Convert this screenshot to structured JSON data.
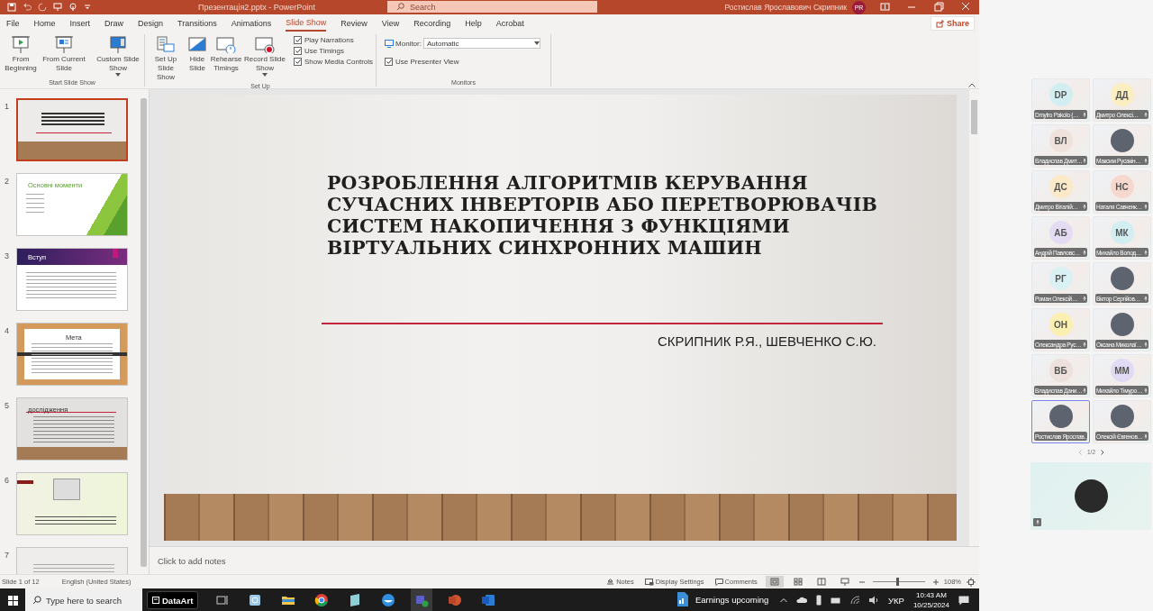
{
  "title_bar": {
    "file_title": "Презентація2.pptx - PowerPoint",
    "search": {
      "placeholder": "Search"
    },
    "user_name": "Ростислав Ярославович Скрипник",
    "avatar": "PR"
  },
  "tabs": [
    {
      "label": "File",
      "selected": false
    },
    {
      "label": "Home",
      "selected": false
    },
    {
      "label": "Insert",
      "selected": false
    },
    {
      "label": "Draw",
      "selected": false
    },
    {
      "label": "Design",
      "selected": false
    },
    {
      "label": "Transitions",
      "selected": false
    },
    {
      "label": "Animations",
      "selected": false
    },
    {
      "label": "Slide Show",
      "selected": true
    },
    {
      "label": "Review",
      "selected": false
    },
    {
      "label": "View",
      "selected": false
    },
    {
      "label": "Recording",
      "selected": false
    },
    {
      "label": "Help",
      "selected": false
    },
    {
      "label": "Acrobat",
      "selected": false
    }
  ],
  "share_button": "Share",
  "ribbon": {
    "groups": [
      {
        "label": "Start Slide Show",
        "items": [
          {
            "kind": "button",
            "label": "From Beginning",
            "dropdown": false
          },
          {
            "kind": "button",
            "label": "From Current Slide",
            "dropdown": false
          },
          {
            "kind": "button",
            "label": "Custom Slide Show",
            "dropdown": true
          }
        ]
      },
      {
        "label": "Set Up",
        "items": [
          {
            "kind": "button",
            "label": "Set Up Slide Show",
            "dropdown": false
          },
          {
            "kind": "button",
            "label": "Hide Slide",
            "dropdown": false
          },
          {
            "kind": "button",
            "label": "Rehearse Timings",
            "dropdown": false
          },
          {
            "kind": "button",
            "label": "Record Slide Show",
            "dropdown": true
          },
          {
            "kind": "checks",
            "checks": [
              {
                "label": "Play Narrations",
                "checked": true
              },
              {
                "label": "Use Timings",
                "checked": true
              },
              {
                "label": "Show Media Controls",
                "checked": true
              }
            ]
          }
        ]
      },
      {
        "label": "Monitors",
        "items": [
          {
            "kind": "monitor",
            "label": "Monitor:",
            "value": "Automatic",
            "checks": [
              {
                "label": "Use Presenter View",
                "checked": true
              }
            ]
          }
        ]
      }
    ]
  },
  "thumbnails": [
    {
      "number": "1",
      "selected": true,
      "kind": "wood"
    },
    {
      "number": "2",
      "selected": false,
      "kind": "green",
      "title": "Основні моменти"
    },
    {
      "number": "3",
      "selected": false,
      "kind": "purple",
      "title": "Вступ"
    },
    {
      "number": "4",
      "selected": false,
      "kind": "framed",
      "title": "Мета"
    },
    {
      "number": "5",
      "selected": false,
      "kind": "gray",
      "title": "дослідження"
    },
    {
      "number": "6",
      "selected": false,
      "kind": "lime"
    },
    {
      "number": "7",
      "selected": false,
      "kind": "plain"
    }
  ],
  "slide": {
    "title_lines": [
      "РОЗРОБЛЕННЯ АЛГОРИТМІВ КЕРУВАННЯ",
      "СУЧАСНИХ ІНВЕРТОРІВ АБО ПЕРЕТВОРЮВАЧІВ",
      "СИСТЕМ НАКОПИЧЕННЯ З ФУНКЦІЯМИ",
      "ВІРТУАЛЬНИХ СИНХРОННИХ МАШИН"
    ],
    "author": "СКРИПНИК Р.Я., ШЕВЧЕНКО С.Ю."
  },
  "notes": {
    "placeholder": "Click to add notes"
  },
  "status_bar": {
    "slide_counter": "Slide 1 of 12",
    "language": "English (United States)",
    "notes_button": "Notes",
    "display_settings_button": "Display Settings",
    "comments_button": "Comments",
    "zoom": {
      "level": 0.47,
      "reading": "108%"
    }
  },
  "taskbar": {
    "search": {
      "placeholder": "Type here to search"
    },
    "pinned_logo": "DataArt",
    "weather": "Earnings upcoming",
    "language": "УКР",
    "time": "10:43 AM",
    "date": "10/25/2024"
  },
  "participants": [
    {
      "kind": "initials",
      "initials": "DP",
      "color": "#d3eef0",
      "name": "Dmytro Pakolo (…",
      "selected": false
    },
    {
      "kind": "initials",
      "initials": "ДД",
      "color": "#fbeec0",
      "name": "Дмитро Олексі…",
      "selected": false
    },
    {
      "kind": "initials",
      "initials": "ВЛ",
      "color": "#efe1dc",
      "name": "Владислав Дмит…",
      "selected": false
    },
    {
      "kind": "photo",
      "name": "Максим Русакін…",
      "selected": false
    },
    {
      "kind": "initials",
      "initials": "ДС",
      "color": "#fbe9c8",
      "name": "Дмитро Віталій…",
      "selected": false
    },
    {
      "kind": "initials",
      "initials": "НС",
      "color": "#f6d8cf",
      "name": "Наталя Савченк…",
      "selected": false
    },
    {
      "kind": "initials",
      "initials": "АБ",
      "color": "#e4dcf2",
      "name": "Андрій Павловс…",
      "selected": false
    },
    {
      "kind": "initials",
      "initials": "МК",
      "color": "#d3eef0",
      "name": "Михайло Волод…",
      "selected": false
    },
    {
      "kind": "initials",
      "initials": "РГ",
      "color": "#daf1f4",
      "name": "Роман Олексій…",
      "selected": false
    },
    {
      "kind": "photo",
      "name": "Віктор Сергійов…",
      "selected": false
    },
    {
      "kind": "initials",
      "initials": "ОН",
      "color": "#fcefb2",
      "name": "Олександра Рус…",
      "selected": false
    },
    {
      "kind": "photo",
      "name": "Оксана Миколаї…",
      "selected": false
    },
    {
      "kind": "initials",
      "initials": "ВБ",
      "color": "#eee0dc",
      "name": "Владислав Дани…",
      "selected": false
    },
    {
      "kind": "initials",
      "initials": "ММ",
      "color": "#e0daf4",
      "name": "Михайло Тімуро…",
      "selected": false
    },
    {
      "kind": "photo",
      "name": "Ростислав Ярослав…",
      "selected": true
    },
    {
      "kind": "photo",
      "name": "Олексій Євгенов…",
      "selected": false
    }
  ],
  "pager": "1/2"
}
